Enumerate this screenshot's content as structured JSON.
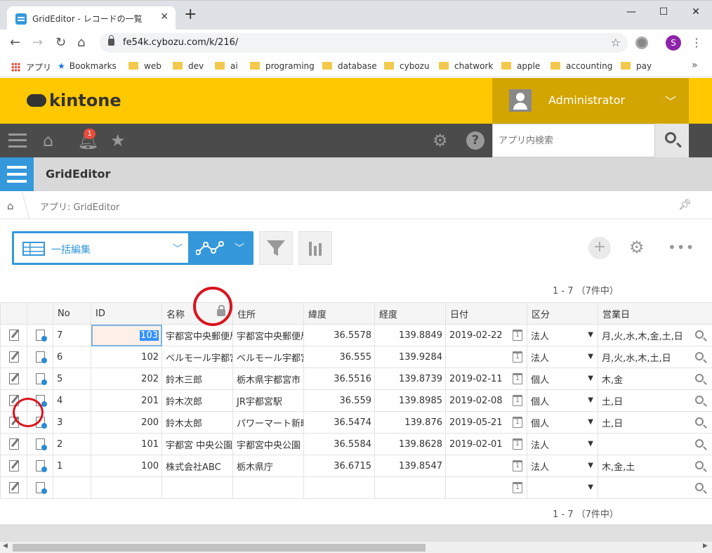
{
  "browser": {
    "tab_title": "GridEditor - レコードの一覧",
    "url": "fe54k.cybozu.com/k/216/",
    "profile_initial": "S",
    "bookmarks": [
      "アプリ",
      "Bookmarks",
      "web",
      "dev",
      "ai",
      "programing",
      "database",
      "cybozu",
      "chatwork",
      "apple",
      "accounting",
      "pay"
    ]
  },
  "header": {
    "logo": "kintone",
    "user": "Administrator",
    "notification_count": "1",
    "search_placeholder": "アプリ内検索"
  },
  "app": {
    "title": "GridEditor",
    "breadcrumb": "アプリ: GridEditor"
  },
  "view": {
    "name": "一括編集",
    "count_top": "1 - 7 （7件中）",
    "count_bottom": "1 - 7 （7件中）"
  },
  "grid": {
    "columns": [
      "No",
      "ID",
      "名称",
      "住所",
      "緯度",
      "経度",
      "日付",
      "区分",
      "営業日"
    ],
    "rows": [
      {
        "no": "7",
        "id": "103",
        "name": "宇都宮中央郵便局",
        "address": "宇都宮中央郵便局",
        "lat": "36.5578",
        "lng": "139.8849",
        "date": "2019-02-22",
        "kubun": "法人",
        "days": "月,火,水,木,金,土,日"
      },
      {
        "no": "6",
        "id": "102",
        "name": "ベルモール宇都宮",
        "address": "ベルモール宇都宮",
        "lat": "36.555",
        "lng": "139.9284",
        "date": "",
        "kubun": "法人",
        "days": "月,火,水,木,土,日"
      },
      {
        "no": "5",
        "id": "202",
        "name": "鈴木三郎",
        "address": "栃木県宇都宮市",
        "lat": "36.5516",
        "lng": "139.8739",
        "date": "2019-02-11",
        "kubun": "個人",
        "days": "木,金"
      },
      {
        "no": "4",
        "id": "201",
        "name": "鈴木次郎",
        "address": "JR宇都宮駅",
        "lat": "36.559",
        "lng": "139.8985",
        "date": "2019-02-08",
        "kubun": "個人",
        "days": "土,日"
      },
      {
        "no": "3",
        "id": "200",
        "name": "鈴木太郎",
        "address": "パワーマート新町",
        "lat": "36.5474",
        "lng": "139.876",
        "date": "2019-05-21",
        "kubun": "個人",
        "days": "土,日"
      },
      {
        "no": "2",
        "id": "101",
        "name": "宇都宮 中央公園",
        "address": "宇都宮中央公園",
        "lat": "36.5584",
        "lng": "139.8628",
        "date": "2019-02-01",
        "kubun": "法人",
        "days": ""
      },
      {
        "no": "1",
        "id": "100",
        "name": "株式会社ABC",
        "address": "栃木県庁",
        "lat": "36.6715",
        "lng": "139.8547",
        "date": "",
        "kubun": "法人",
        "days": "木,金,土"
      },
      {
        "no": "",
        "id": "",
        "name": "",
        "address": "",
        "lat": "",
        "lng": "",
        "date": "",
        "kubun": "",
        "days": ""
      }
    ]
  },
  "colors": {
    "header_yellow": "#ffc800",
    "user_box": "#d3a500",
    "nav_dark": "#4b4b4b",
    "accent_blue": "#3498db",
    "annotation_red": "#d9141e"
  }
}
